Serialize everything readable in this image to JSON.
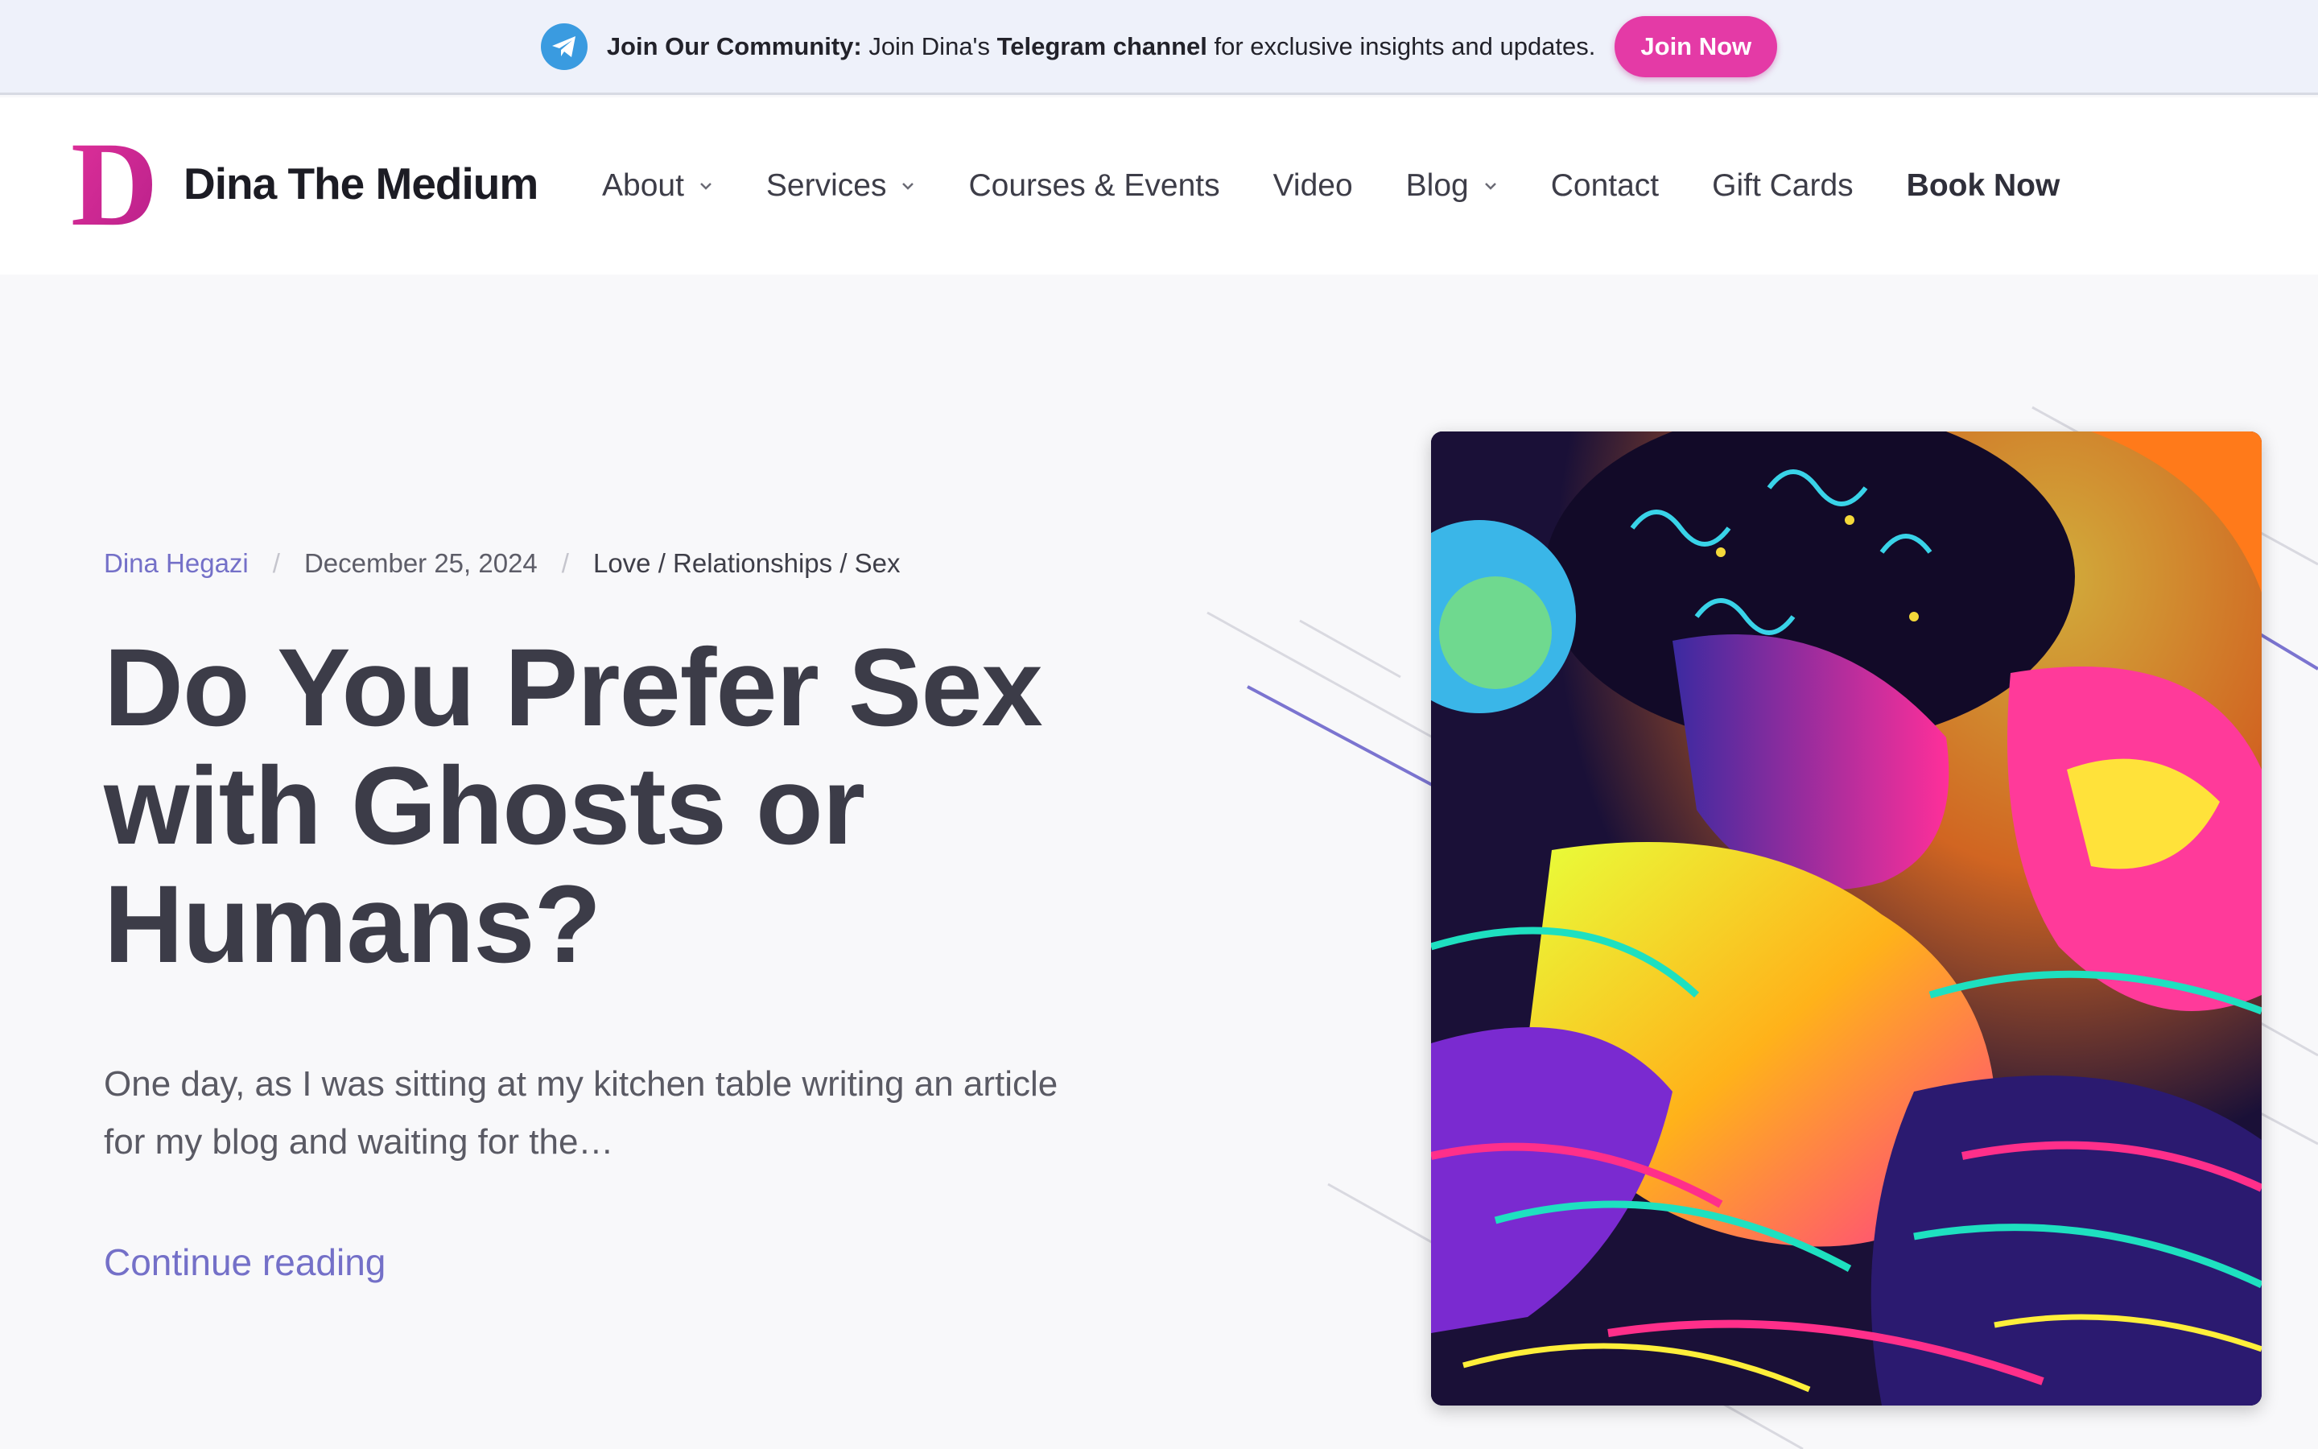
{
  "banner": {
    "icon": "telegram-icon",
    "lead": "Join Our Community:",
    "text_before": " Join Dina's ",
    "channel": "Telegram channel",
    "text_after": " for exclusive insights and updates.",
    "button_label": "Join Now"
  },
  "header": {
    "logo_letter": "D",
    "site_name": "Dina The Medium"
  },
  "nav": {
    "about": "About",
    "services": "Services",
    "courses": "Courses & Events",
    "video": "Video",
    "blog": "Blog",
    "contact": "Contact",
    "gift_cards": "Gift Cards",
    "book_now": "Book Now"
  },
  "post": {
    "author": "Dina Hegazi",
    "date": "December 25, 2024",
    "categories": "Love / Relationships / Sex",
    "title": "Do You Prefer Sex with Ghosts or Humans?",
    "excerpt": "One day, as I was sitting at my kitchen table writing an article for my blog and waiting for the…",
    "continue_label": "Continue reading"
  },
  "colors": {
    "accent_pink": "#e43aa6",
    "accent_purple": "#7470c8",
    "banner_bg": "#eef1fa",
    "page_bg": "#f8f8fa"
  }
}
